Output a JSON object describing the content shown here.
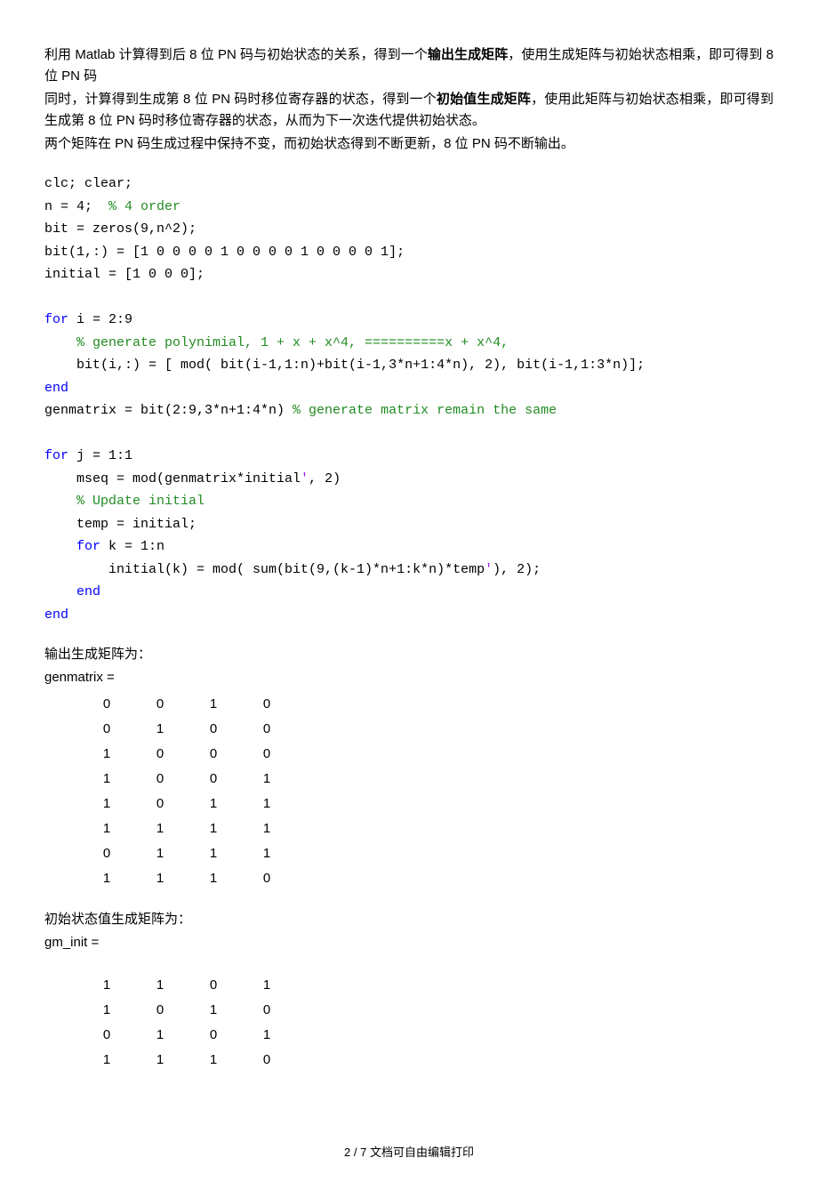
{
  "para1_a": "利用 Matlab 计算得到后 8 位 PN 码与初始状态的关系，得到一个",
  "para1_bold": "输出生成矩阵",
  "para1_b": "，使用生成矩阵与初始状态相乘，即可得到 8 位 PN 码",
  "para2_a": "同时，计算得到生成第 8 位 PN 码时移位寄存器的状态，得到一个",
  "para2_bold": "初始值生成矩阵",
  "para2_b": "，使用此矩阵与初始状态相乘，即可得到生成第 8 位 PN 码时移位寄存器的状态，从而为下一次迭代提供初始状态。",
  "para3": "两个矩阵在 PN 码生成过程中保持不变，而初始状态得到不断更新，8 位 PN 码不断输出。",
  "code": {
    "l1": "clc; clear;",
    "l2a": "n = 4;  ",
    "l2b": "% 4 order",
    "l3": "bit = zeros(9,n^2);",
    "l4": "bit(1,:) = [1 0 0 0 0 1 0 0 0 0 1 0 0 0 0 1];",
    "l5": "initial = [1 0 0 0];",
    "l6a": "for",
    "l6b": " i = 2:9",
    "l7": "    % generate polynimial, 1 + x + x^4, ==========x + x^4,",
    "l8": "    bit(i,:) = [ mod( bit(i-1,1:n)+bit(i-1,3*n+1:4*n), 2), bit(i-1,1:3*n)];",
    "l9": "end",
    "l10a": "genmatrix = bit(2:9,3*n+1:4*n) ",
    "l10b": "% generate matrix remain the same",
    "l11a": "for",
    "l11b": " j = 1:1",
    "l12a": "    mseq = mod(genmatrix*initial",
    "l12b": "'",
    "l12c": ", 2)",
    "l13": "    % Update initial",
    "l14": "    temp = initial;",
    "l15a": "    for",
    "l15b": " k = 1:n",
    "l16a": "        initial(k) = mod( sum(bit(9,(k-1)*n+1:k*n)*temp",
    "l16b": "'",
    "l16c": "), 2);",
    "l17": "    end",
    "l18": "end"
  },
  "out1_label": "输出生成矩阵为：",
  "out1_name": "genmatrix =",
  "out1_matrix": [
    [
      0,
      0,
      1,
      0
    ],
    [
      0,
      1,
      0,
      0
    ],
    [
      1,
      0,
      0,
      0
    ],
    [
      1,
      0,
      0,
      1
    ],
    [
      1,
      0,
      1,
      1
    ],
    [
      1,
      1,
      1,
      1
    ],
    [
      0,
      1,
      1,
      1
    ],
    [
      1,
      1,
      1,
      0
    ]
  ],
  "out2_label": "初始状态值生成矩阵为：",
  "out2_name": "gm_init =",
  "out2_matrix": [
    [
      1,
      1,
      0,
      1
    ],
    [
      1,
      0,
      1,
      0
    ],
    [
      0,
      1,
      0,
      1
    ],
    [
      1,
      1,
      1,
      0
    ]
  ],
  "footer": "2 / 7 文档可自由编辑打印"
}
